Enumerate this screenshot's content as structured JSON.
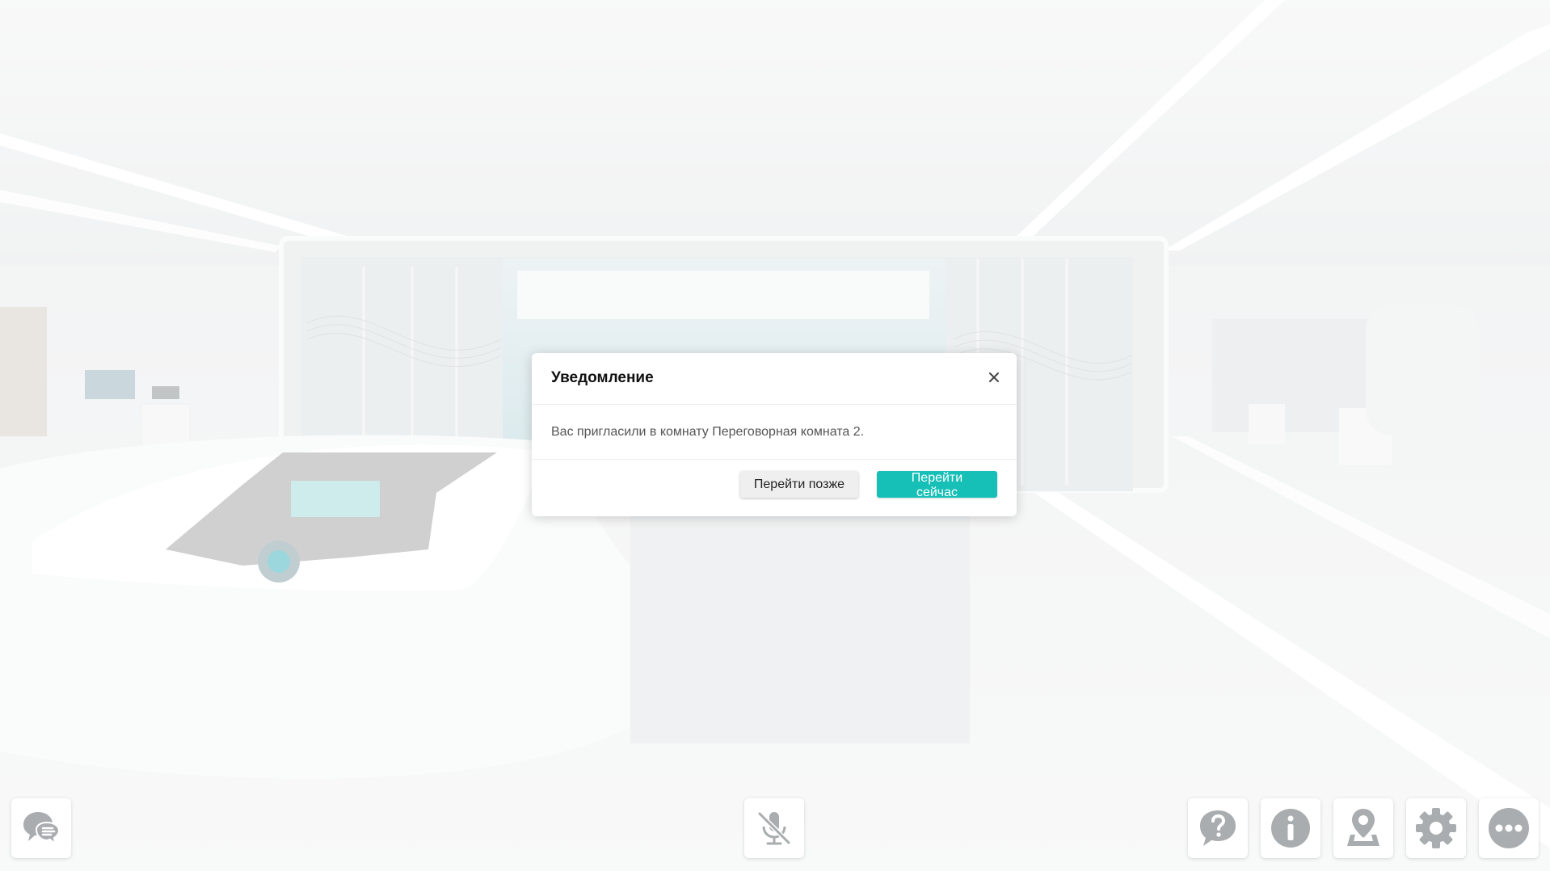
{
  "dialog": {
    "title": "Уведомление",
    "message": "Вас пригласили в комнату Переговорная комната 2.",
    "later_label": "Перейти позже",
    "now_label": "Перейти сейчас"
  },
  "toolbar": {
    "left": [
      {
        "icon": "chat-icon"
      }
    ],
    "center": [
      {
        "icon": "microphone-muted-icon"
      }
    ],
    "right": [
      {
        "icon": "help-icon"
      },
      {
        "icon": "info-icon"
      },
      {
        "icon": "map-pin-icon"
      },
      {
        "icon": "settings-icon"
      },
      {
        "icon": "more-icon"
      }
    ]
  },
  "colors": {
    "accent": "#17c0b7",
    "icon_gray": "#a9adaf",
    "background": "#eef0f1"
  }
}
